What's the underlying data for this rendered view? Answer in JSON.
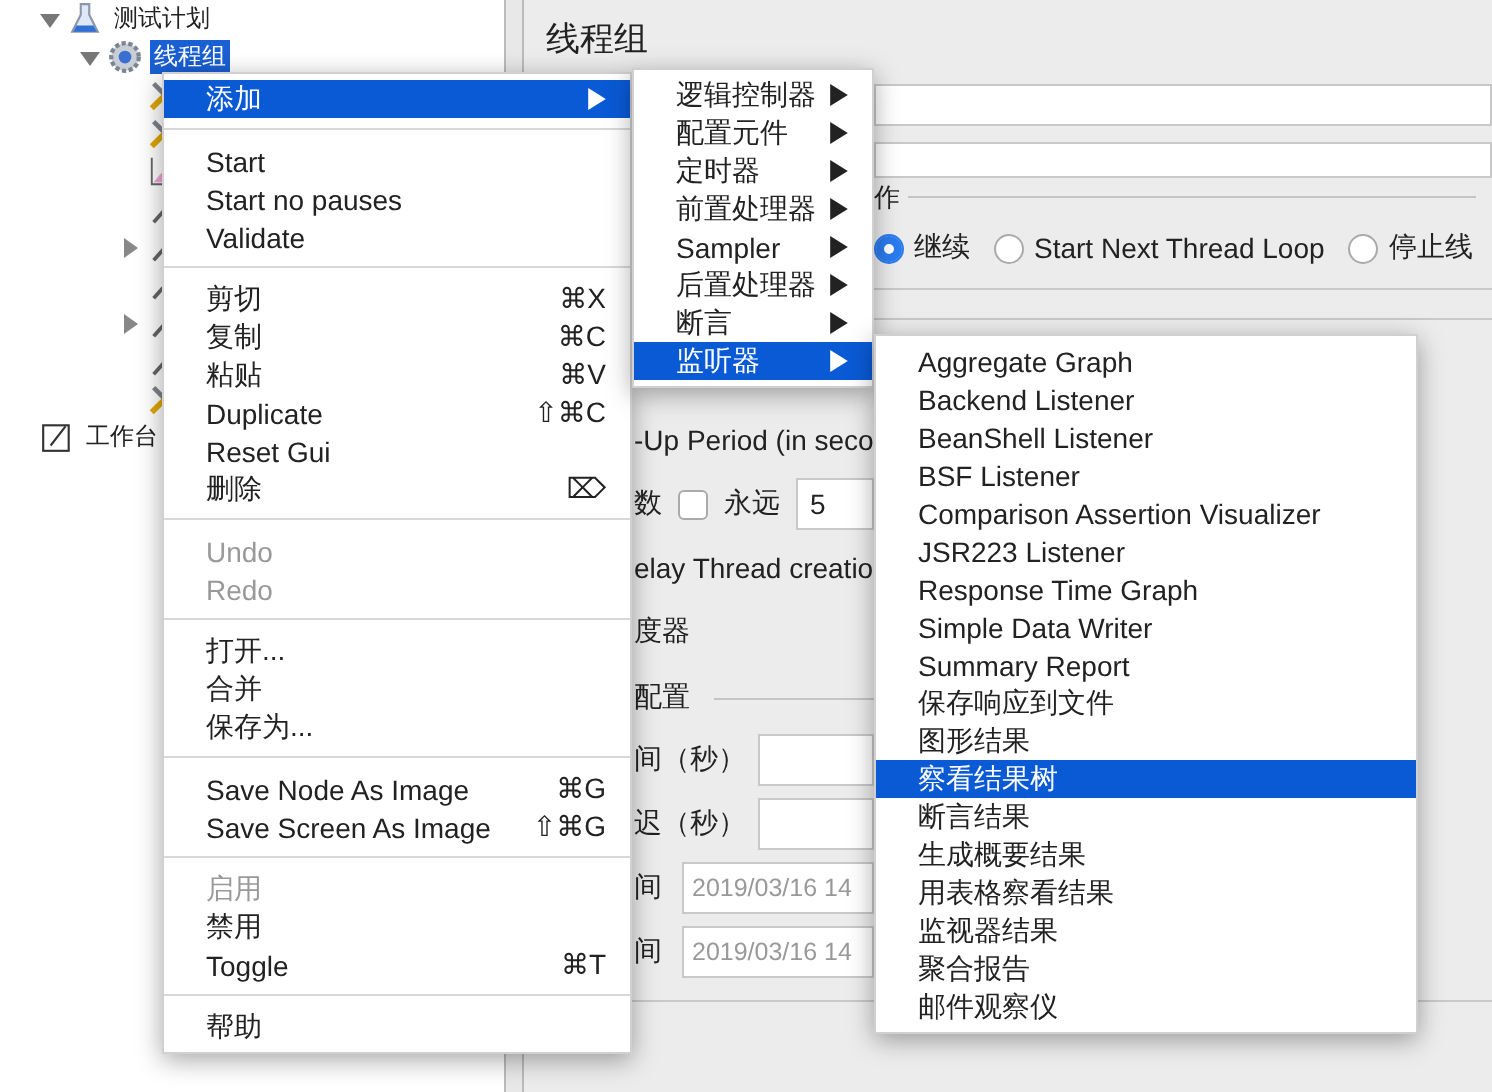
{
  "tree": [
    {
      "label": "测试计划",
      "kind": "flask",
      "expanded": true,
      "selected": false,
      "children": [
        {
          "label": "线程组",
          "kind": "gear",
          "expanded": true,
          "selected": true,
          "children": [
            {
              "kind": "tools",
              "selected": false
            },
            {
              "kind": "tools",
              "selected": false
            },
            {
              "kind": "chart",
              "selected": false
            },
            {
              "kind": "pipette",
              "selected": false
            },
            {
              "kind": "pipette",
              "expanded": false,
              "selected": false
            },
            {
              "kind": "pipette-green",
              "selected": false
            },
            {
              "kind": "pipette",
              "expanded": false,
              "selected": false
            },
            {
              "kind": "pipette",
              "selected": false
            },
            {
              "kind": "tools",
              "selected": false
            }
          ]
        }
      ]
    },
    {
      "label": "工作台",
      "kind": "notepad",
      "selected": false
    }
  ],
  "panel": {
    "title": "线程组",
    "action_group": {
      "label": "作",
      "options": [
        {
          "label": "继续",
          "selected": true
        },
        {
          "label": "Start Next Thread Loop",
          "selected": false
        },
        {
          "label": "停止线",
          "selected": false
        }
      ]
    },
    "rows": [
      {
        "kind": "text",
        "label": "-Up Period (in seco"
      },
      {
        "kind": "loop",
        "label": "数",
        "checkbox_label": "永远",
        "checked": false,
        "value": "5"
      },
      {
        "kind": "text",
        "label": "elay Thread creatio"
      },
      {
        "kind": "text",
        "label": "度器"
      },
      {
        "kind": "group",
        "label": "配置"
      },
      {
        "kind": "field",
        "label": "间（秒）"
      },
      {
        "kind": "field",
        "label": "迟（秒）"
      },
      {
        "kind": "date",
        "label": "间",
        "value": "2019/03/16 14"
      },
      {
        "kind": "date",
        "label": "间",
        "value": "2019/03/16 14"
      }
    ]
  },
  "context_menu": {
    "groups": [
      [
        {
          "label": "添加",
          "submenu": true,
          "selected": true,
          "disabled": false
        }
      ],
      [
        {
          "label": "Start",
          "selected": false,
          "disabled": false
        },
        {
          "label": "Start no pauses",
          "selected": false,
          "disabled": false
        },
        {
          "label": "Validate",
          "selected": false,
          "disabled": false
        }
      ],
      [
        {
          "label": "剪切",
          "shortcut": "⌘X",
          "selected": false,
          "disabled": false
        },
        {
          "label": "复制",
          "shortcut": "⌘C",
          "selected": false,
          "disabled": false
        },
        {
          "label": "粘贴",
          "shortcut": "⌘V",
          "selected": false,
          "disabled": false
        },
        {
          "label": "Duplicate",
          "shortcut": "⇧⌘C",
          "selected": false,
          "disabled": false
        },
        {
          "label": "Reset Gui",
          "selected": false,
          "disabled": false
        },
        {
          "label": "删除",
          "shortcut": "⌦",
          "selected": false,
          "disabled": false
        }
      ],
      [
        {
          "label": "Undo",
          "selected": false,
          "disabled": true
        },
        {
          "label": "Redo",
          "selected": false,
          "disabled": true
        }
      ],
      [
        {
          "label": "打开...",
          "selected": false,
          "disabled": false
        },
        {
          "label": "合并",
          "selected": false,
          "disabled": false
        },
        {
          "label": "保存为...",
          "selected": false,
          "disabled": false
        }
      ],
      [
        {
          "label": "Save Node As Image",
          "shortcut": "⌘G",
          "selected": false,
          "disabled": false
        },
        {
          "label": "Save Screen As Image",
          "shortcut": "⇧⌘G",
          "selected": false,
          "disabled": false
        }
      ],
      [
        {
          "label": "启用",
          "selected": false,
          "disabled": true
        },
        {
          "label": "禁用",
          "selected": false,
          "disabled": false
        },
        {
          "label": "Toggle",
          "shortcut": "⌘T",
          "selected": false,
          "disabled": false
        }
      ],
      [
        {
          "label": "帮助",
          "selected": false,
          "disabled": false
        }
      ]
    ]
  },
  "add_submenu": [
    {
      "label": "逻辑控制器",
      "submenu": true,
      "selected": false
    },
    {
      "label": "配置元件",
      "submenu": true,
      "selected": false
    },
    {
      "label": "定时器",
      "submenu": true,
      "selected": false
    },
    {
      "label": "前置处理器",
      "submenu": true,
      "selected": false
    },
    {
      "label": "Sampler",
      "submenu": true,
      "selected": false
    },
    {
      "label": "后置处理器",
      "submenu": true,
      "selected": false
    },
    {
      "label": "断言",
      "submenu": true,
      "selected": false
    },
    {
      "label": "监听器",
      "submenu": true,
      "selected": true
    }
  ],
  "listener_submenu": [
    {
      "label": "Aggregate Graph",
      "selected": false
    },
    {
      "label": "Backend Listener",
      "selected": false
    },
    {
      "label": "BeanShell Listener",
      "selected": false
    },
    {
      "label": "BSF Listener",
      "selected": false
    },
    {
      "label": "Comparison Assertion Visualizer",
      "selected": false
    },
    {
      "label": "JSR223 Listener",
      "selected": false
    },
    {
      "label": "Response Time Graph",
      "selected": false
    },
    {
      "label": "Simple Data Writer",
      "selected": false
    },
    {
      "label": "Summary Report",
      "selected": false
    },
    {
      "label": "保存响应到文件",
      "selected": false
    },
    {
      "label": "图形结果",
      "selected": false
    },
    {
      "label": "察看结果树",
      "selected": true
    },
    {
      "label": "断言结果",
      "selected": false
    },
    {
      "label": "生成概要结果",
      "selected": false
    },
    {
      "label": "用表格察看结果",
      "selected": false
    },
    {
      "label": "监视器结果",
      "selected": false
    },
    {
      "label": "聚合报告",
      "selected": false
    },
    {
      "label": "邮件观察仪",
      "selected": false
    }
  ]
}
